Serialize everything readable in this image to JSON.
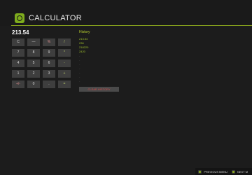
{
  "app": {
    "title": "CALCULATOR",
    "accent_color": "#8aa61c",
    "icon": "calculator-icon"
  },
  "display": {
    "value": "213.54"
  },
  "keypad": {
    "keys": [
      "C",
      "—",
      "%",
      "/",
      "7",
      "8",
      "9",
      "*",
      "4",
      "5",
      "6",
      "-",
      "1",
      "2",
      "3",
      "+",
      "+/-",
      "0",
      ".",
      "="
    ]
  },
  "history": {
    "title": "History",
    "entries": [
      "213.54",
      "236",
      "218220",
      "2420",
      "-",
      "-",
      "-",
      "-",
      "-",
      "-",
      "-"
    ],
    "clear_label": "CLEAR HISTORY"
  },
  "footer": {
    "previous_menu_label": "PREVIOUS MENU",
    "next_label": "NEXT M"
  }
}
